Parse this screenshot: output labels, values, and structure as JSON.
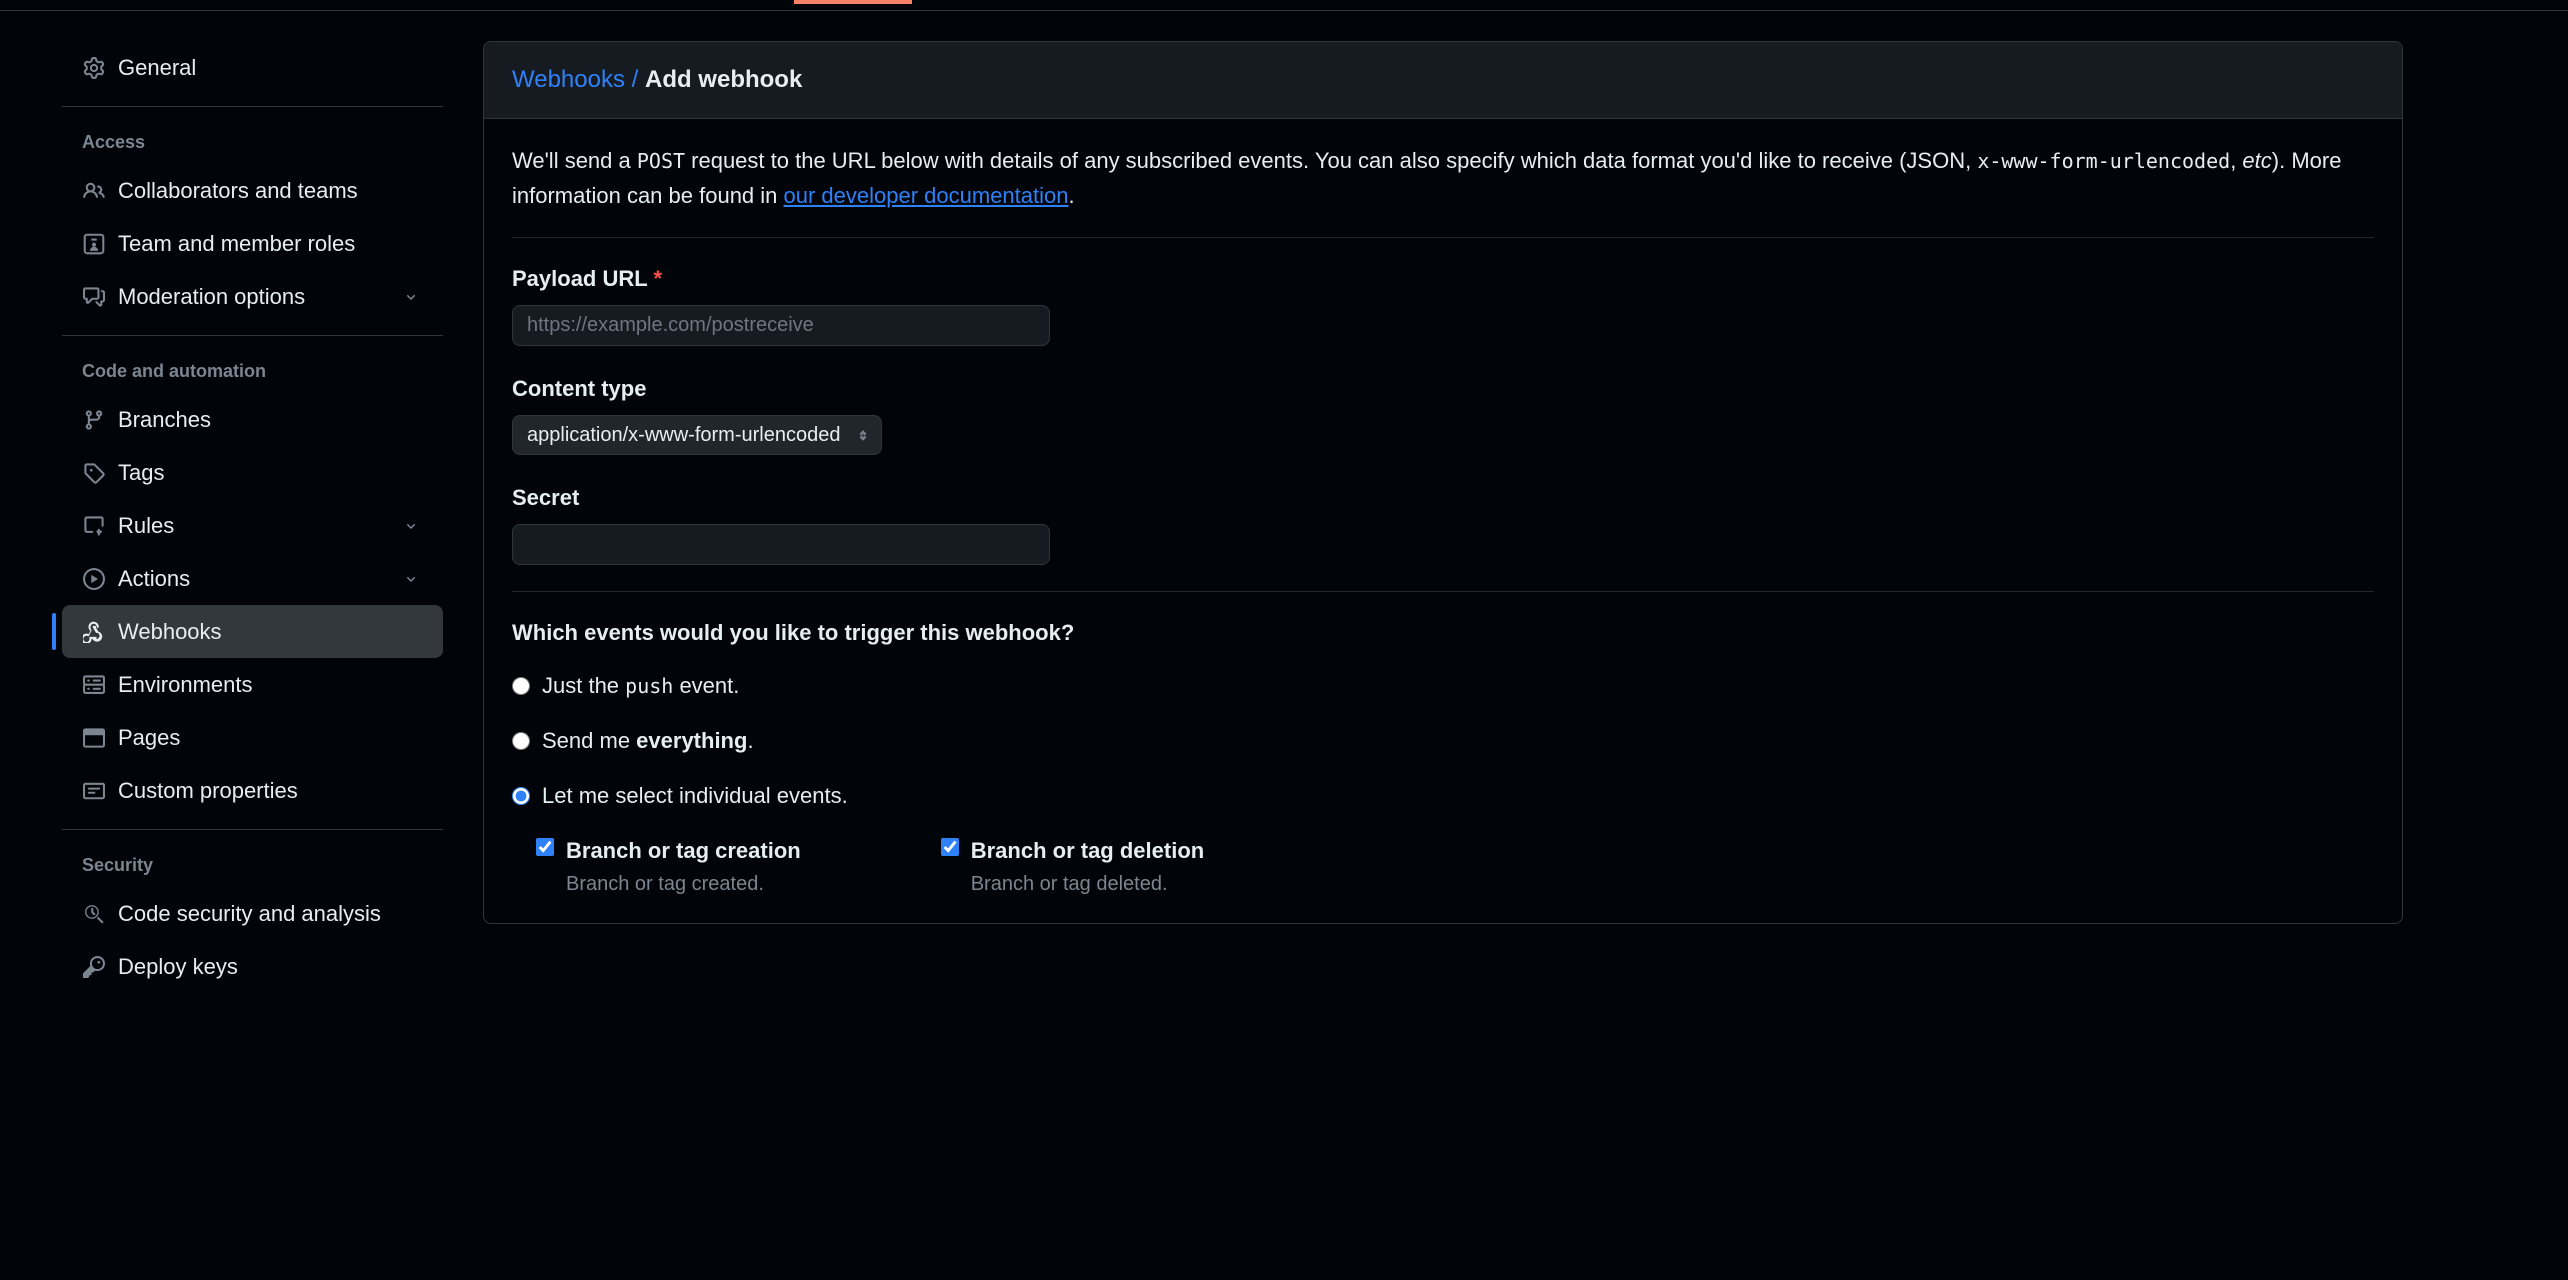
{
  "sidebar": {
    "general": "General",
    "sections": {
      "access": {
        "title": "Access",
        "items": [
          {
            "label": "Collaborators and teams"
          },
          {
            "label": "Team and member roles"
          },
          {
            "label": "Moderation options",
            "expandable": true
          }
        ]
      },
      "code": {
        "title": "Code and automation",
        "items": [
          {
            "label": "Branches"
          },
          {
            "label": "Tags"
          },
          {
            "label": "Rules",
            "expandable": true
          },
          {
            "label": "Actions",
            "expandable": true
          },
          {
            "label": "Webhooks",
            "active": true
          },
          {
            "label": "Environments"
          },
          {
            "label": "Pages"
          },
          {
            "label": "Custom properties"
          }
        ]
      },
      "security": {
        "title": "Security",
        "items": [
          {
            "label": "Code security and analysis"
          },
          {
            "label": "Deploy keys"
          }
        ]
      }
    }
  },
  "breadcrumb": {
    "parent": "Webhooks",
    "sep": "/",
    "current": "Add webhook"
  },
  "intro": {
    "pre": "We'll send a ",
    "code1": "POST",
    "mid1": " request to the URL below with details of any subscribed events. You can also specify which data format you'd like to receive (JSON, ",
    "code2": "x-www-form-urlencoded",
    "mid2": ", ",
    "em": "etc",
    "mid3": "). More information can be found in ",
    "link": "our developer documentation",
    "post": "."
  },
  "form": {
    "payload_label": "Payload URL",
    "payload_placeholder": "https://example.com/postreceive",
    "content_label": "Content type",
    "content_value": "application/x-www-form-urlencoded",
    "secret_label": "Secret"
  },
  "events": {
    "title": "Which events would you like to trigger this webhook?",
    "radios": {
      "push_pre": "Just the ",
      "push_code": "push",
      "push_post": " event.",
      "everything_pre": "Send me ",
      "everything_strong": "everything",
      "everything_post": ".",
      "select": "Let me select individual events."
    },
    "list": [
      {
        "name": "Branch or tag creation",
        "desc": "Branch or tag created."
      },
      {
        "name": "Branch or tag deletion",
        "desc": "Branch or tag deleted."
      }
    ]
  }
}
